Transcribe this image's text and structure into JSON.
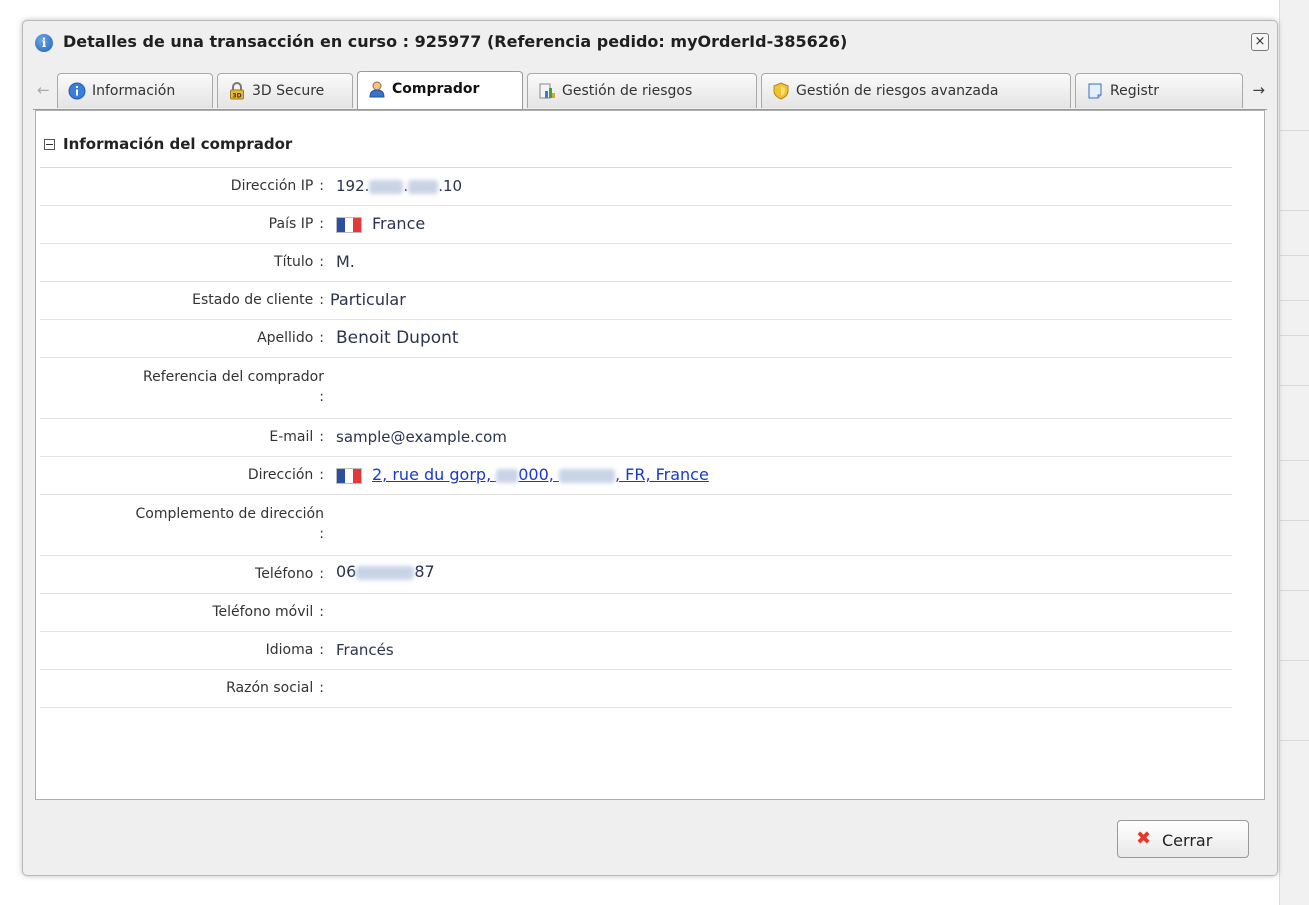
{
  "window": {
    "title": "Detalles de una transacción en curso : 925977 (Referencia pedido: myOrderId-385626)",
    "close_glyph": "×"
  },
  "tabs": [
    {
      "label": "Información",
      "icon": "info-icon",
      "active": false
    },
    {
      "label": "3D Secure",
      "icon": "3d-secure-icon",
      "active": false
    },
    {
      "label": "Comprador",
      "icon": "buyer-icon",
      "active": true
    },
    {
      "label": "Gestión de riesgos",
      "icon": "risk-chart-icon",
      "active": false
    },
    {
      "label": "Gestión de riesgos avanzada",
      "icon": "shield-icon",
      "active": false
    },
    {
      "label": "Registr",
      "icon": "log-icon",
      "active": false
    }
  ],
  "section": {
    "title": "Información del comprador"
  },
  "fields": {
    "ip_address": {
      "label": "Dirección IP",
      "value_start": "192.",
      "value_mid": ".",
      "value_end": ".10"
    },
    "ip_country": {
      "label": "País IP",
      "value": "France"
    },
    "title": {
      "label": "Título",
      "value": "M."
    },
    "customer_status": {
      "label": "Estado de cliente",
      "value": "Particular"
    },
    "last_name": {
      "label": "Apellido",
      "value": "Benoit Dupont"
    },
    "buyer_reference": {
      "label": "Referencia del comprador",
      "value": ""
    },
    "email": {
      "label": "E-mail",
      "value": "sample@example.com"
    },
    "address": {
      "label": "Dirección",
      "value_start": "2, rue du gorp, ",
      "value_mid": "000, ",
      "value_end": ", FR, France"
    },
    "address_complement": {
      "label": "Complemento de dirección",
      "value": ""
    },
    "phone": {
      "label": "Teléfono",
      "value_start": "06",
      "value_end": "87"
    },
    "mobile_phone": {
      "label": "Teléfono móvil",
      "value": ""
    },
    "language": {
      "label": "Idioma",
      "value": "Francés"
    },
    "company_name": {
      "label": "Razón social",
      "value": ""
    }
  },
  "colon": ":",
  "footer": {
    "close_label": "Cerrar"
  },
  "colors": {
    "link": "#1a38cc",
    "close_icon": "#e23b2d",
    "flag_blue": "#2d4fa3",
    "flag_red": "#e03a3a"
  }
}
